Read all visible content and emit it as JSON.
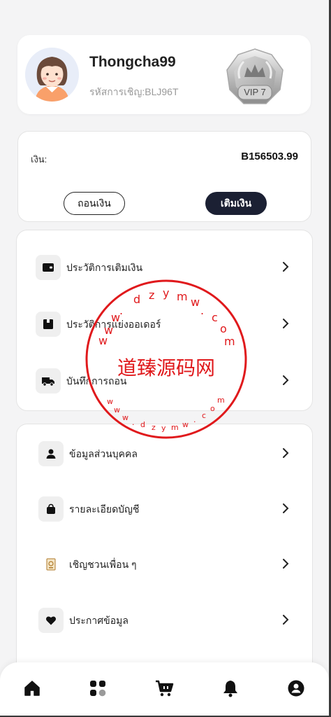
{
  "profile": {
    "username": "Thongcha99",
    "invite_code": "รหัสการเชิญ:BLJ96T",
    "vip_level": "VIP 7"
  },
  "balance": {
    "label": "เงิน:",
    "amount": "B156503.99",
    "withdraw_label": "ถอนเงิน",
    "deposit_label": "เติมเงิน"
  },
  "history_menu": [
    {
      "label": "ประวัติการเติมเงิน",
      "icon": "wallet-icon"
    },
    {
      "label": "ประวัติการแย่งออเดอร์",
      "icon": "box-icon"
    },
    {
      "label": "บันทึกการถอน",
      "icon": "truck-icon"
    }
  ],
  "account_menu": [
    {
      "label": "ข้อมูลส่วนบุคคล",
      "icon": "person-icon"
    },
    {
      "label": "รายละเอียดบัญชี",
      "icon": "bag-icon"
    },
    {
      "label": "เชิญชวนเพื่อน ๆ",
      "icon": "invite-icon"
    },
    {
      "label": "ประกาศข้อมูล",
      "icon": "heart-icon"
    }
  ],
  "watermark": {
    "main_text": "道臻源码网",
    "ring_text": "www.dzymw.com"
  },
  "bottom_nav": [
    {
      "icon": "home-icon"
    },
    {
      "icon": "grid-icon"
    },
    {
      "icon": "cart-icon"
    },
    {
      "icon": "bell-icon"
    },
    {
      "icon": "user-icon"
    }
  ],
  "colors": {
    "accent_dark": "#1b2033",
    "watermark_red": "#e0191c",
    "background": "#f4f4f5"
  }
}
